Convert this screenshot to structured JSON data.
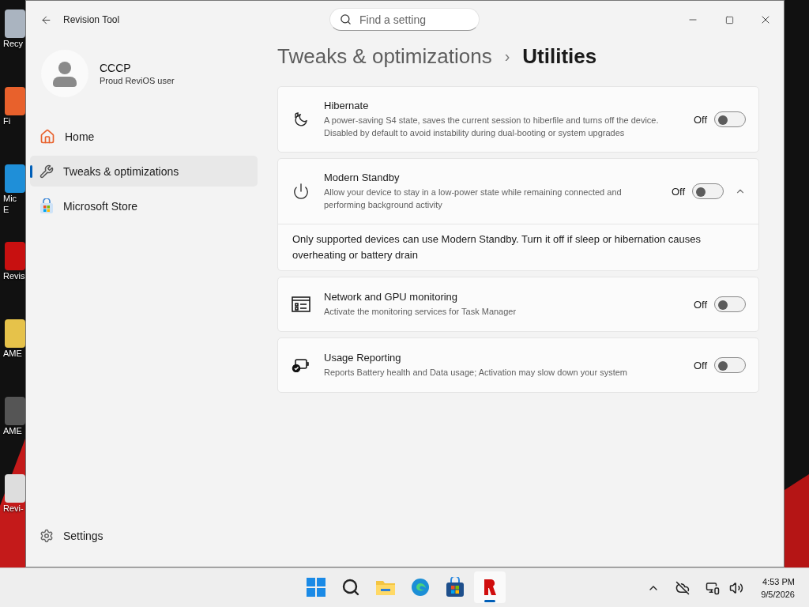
{
  "desktop_icons": [
    {
      "kind": "bin",
      "labels": [
        "Recy"
      ]
    },
    {
      "kind": "firefox",
      "labels": [
        "Fi"
      ]
    },
    {
      "kind": "edge",
      "labels": [
        "Mic",
        "E"
      ]
    },
    {
      "kind": "revision",
      "labels": [
        "Revis"
      ]
    },
    {
      "kind": "zip",
      "labels": [
        "AME"
      ]
    },
    {
      "kind": "cube",
      "labels": [
        "AME"
      ]
    },
    {
      "kind": "doc",
      "labels": [
        "Revi-"
      ]
    }
  ],
  "window": {
    "title": "Revision Tool",
    "search": {
      "placeholder": "Find a setting"
    }
  },
  "profile": {
    "name": "CCCP",
    "subtitle": "Proud ReviOS user"
  },
  "nav": [
    {
      "kind": "home",
      "label": "Home",
      "selected": false
    },
    {
      "kind": "wrench",
      "label": "Tweaks & optimizations",
      "selected": true
    },
    {
      "kind": "store",
      "label": "Microsoft Store",
      "selected": false
    }
  ],
  "footer_nav": {
    "kind": "settings",
    "label": "Settings"
  },
  "breadcrumb": {
    "parent": "Tweaks & optimizations",
    "separator": "›",
    "current": "Utilities"
  },
  "settings": [
    {
      "kind": "hibernate",
      "title": "Hibernate",
      "description": "A power-saving S4 state, saves the current session to hiberfile and turns off the device. Disabled by default to avoid instability during dual-booting or system upgrades",
      "state": "Off",
      "on": false
    },
    {
      "kind": "power",
      "title": "Modern Standby",
      "description": "Allow your device to stay in a low-power state while remaining connected and performing background activity",
      "state": "Off",
      "on": false,
      "expanded": true,
      "detail": "Only supported devices can use Modern Standby. Turn it off if sleep or hibernation causes overheating or battery drain"
    },
    {
      "kind": "monitor",
      "title": "Network and GPU monitoring",
      "description": "Activate the monitoring services for Task Manager",
      "state": "Off",
      "on": false
    },
    {
      "kind": "battery",
      "title": "Usage Reporting",
      "description": "Reports Battery health and Data usage; Activation may slow down your system",
      "state": "Off",
      "on": false
    }
  ],
  "taskbar": {
    "apps": [
      {
        "kind": "start",
        "selected": false
      },
      {
        "kind": "search",
        "selected": false
      },
      {
        "kind": "folder",
        "selected": false
      },
      {
        "kind": "edge",
        "selected": false
      },
      {
        "kind": "store",
        "selected": false
      },
      {
        "kind": "revision",
        "selected": true
      }
    ],
    "time": "4:53 PM",
    "date": "9/5/2026"
  }
}
